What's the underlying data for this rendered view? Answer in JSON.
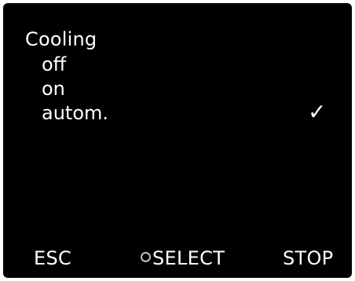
{
  "menu": {
    "title": "Cooling",
    "options": [
      {
        "label": "off",
        "selected": false
      },
      {
        "label": "on",
        "selected": false
      },
      {
        "label": "autom.",
        "selected": true
      }
    ],
    "check_mark": "✓"
  },
  "softkeys": {
    "left_label": "ESC",
    "center_label": "SELECT",
    "right_label": "STOP",
    "center_icon": "rotary-knob-icon"
  },
  "colors": {
    "background": "#000000",
    "text": "#ffffff",
    "knob_icon": "#bdbdbd"
  }
}
